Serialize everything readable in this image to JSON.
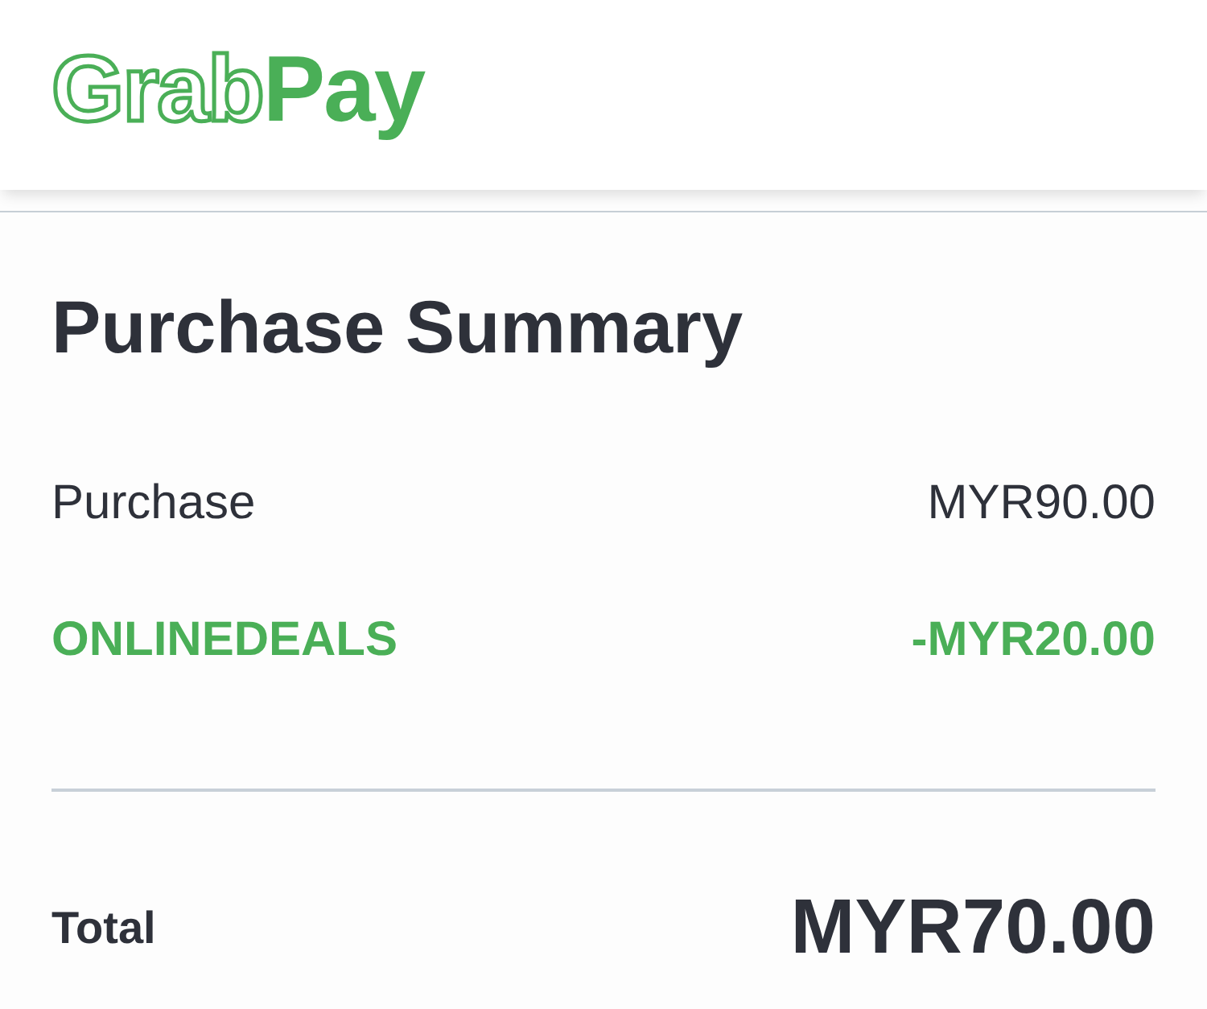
{
  "header": {
    "logo": [
      {
        "text": "Grab",
        "kind": "outline"
      },
      {
        "text": "Pay",
        "kind": "solid"
      }
    ]
  },
  "summary": {
    "title": "Purchase Summary",
    "rows": [
      {
        "label": "Purchase",
        "amount": "MYR90.00",
        "kind": "charge"
      },
      {
        "label": "ONLINEDEALS",
        "amount": "-MYR20.00",
        "kind": "discount"
      }
    ],
    "total": {
      "label": "Total",
      "amount": "MYR70.00"
    }
  }
}
